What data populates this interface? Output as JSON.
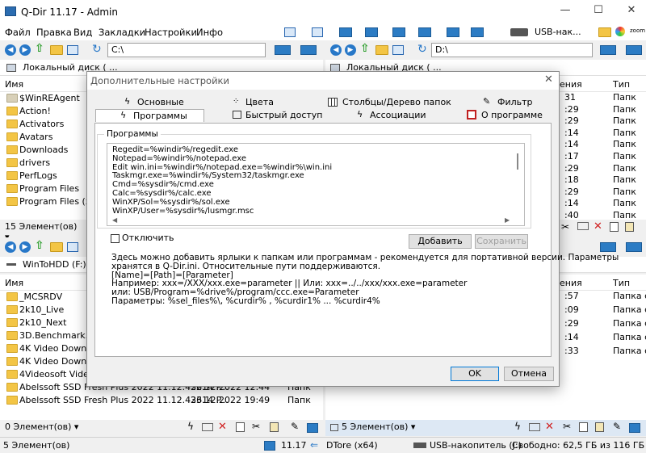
{
  "window": {
    "title": "Q-Dir 11.17 - Admin"
  },
  "menu": [
    "Файл",
    "Правка",
    "Вид",
    "Закладки",
    "Настройки",
    "Инфо"
  ],
  "menu_right": {
    "usb_label": "USB-нак...",
    "zoom_label": "zoom"
  },
  "top_left": {
    "path": "C:\\",
    "addr": "Локальный диск ( ...",
    "col_name": "Имя",
    "rows": [
      "$WinREAgent",
      "Action!",
      "Activators",
      "Avatars",
      "Downloads",
      "drivers",
      "PerfLogs",
      "Program Files",
      "Program Files (x86)"
    ],
    "status": "15 Элемент(ов)"
  },
  "top_right": {
    "path": "D:\\",
    "addr": "Локальный диск ( ...",
    "col_date": "ения",
    "col_type": "Тип",
    "dates": [
      "31",
      ":29",
      ":29",
      ":14",
      ":14",
      ":17",
      ":29",
      ":18",
      ":29",
      ":14",
      ":40"
    ],
    "types": [
      "Папк",
      "Папк",
      "Папк",
      "Папк",
      "Папк",
      "Папк",
      "Папк",
      "Папк",
      "Папк",
      "Папк",
      "Папк"
    ]
  },
  "bottom_left": {
    "addr": "WinToHDD (F:)",
    "col_name": "Имя",
    "rows": [
      {
        "name": "_MCSRDV",
        "date": "",
        "type": ""
      },
      {
        "name": "2k10_Live",
        "date": "",
        "type": ""
      },
      {
        "name": "2k10_Next",
        "date": "",
        "type": ""
      },
      {
        "name": "3D.Benchmark.OK",
        "date": "",
        "type": ""
      },
      {
        "name": "4K Video Downloa",
        "date": "",
        "type": ""
      },
      {
        "name": "4K Video Downloa",
        "date": "",
        "type": ""
      },
      {
        "name": "4Videosoft Video C",
        "date": "",
        "type": ""
      },
      {
        "name": "Abelssoft SSD Fresh Plus 2022 11.12.43614 P...",
        "date": "22.12.2022 12:44",
        "type": "Папк"
      },
      {
        "name": "Abelssoft SSD Fresh Plus 2022 11.12.43614 P...",
        "date": "23.12.2022 19:49",
        "type": "Папк"
      }
    ],
    "status": "0 Элемент(ов)"
  },
  "bottom_right": {
    "col_date": "ения",
    "col_type": "Тип",
    "dates": [
      ":57",
      ":09",
      ":29",
      ":14",
      ":33"
    ],
    "types": [
      "Папка с",
      "Папка с",
      "Папка с",
      "Папка с",
      "Папка с"
    ],
    "status": "5 Элемент(ов)"
  },
  "bottom_bar": {
    "count": "5 Элемент(ов)",
    "version": "11.17",
    "drive": "DTore (x64)",
    "usb": "USB-накопитель (J:)",
    "free": "Свободно: 62,5 ГБ из 116 ГБ"
  },
  "dialog": {
    "title": "Дополнительные настройки",
    "tabs_row1": [
      "Основные",
      "Цвета",
      "Столбцы/Дерево папок",
      "Фильтр"
    ],
    "tabs_row2": [
      "Программы",
      "Быстрый доступ",
      "Ассоциации",
      "О программе"
    ],
    "group_label": "Программы",
    "lines": [
      "Regedit=%windir%/regedit.exe",
      "Notepad=%windir%/notepad.exe",
      "Edit win.ini=%windir%/notepad.exe=%windir%\\win.ini",
      "Taskmgr.exe=%windir%/System32/taskmgr.exe",
      "Cmd=%sysdir%/cmd.exe",
      "Calc=%sysdir%/calc.exe",
      "WinXP/Sol=%sysdir%/sol.exe",
      "WinXP/User=%sysdir%/lusmgr.msc"
    ],
    "disable_label": "Отключить",
    "add_button": "Добавить",
    "save_button": "Сохранить",
    "info_lines": [
      "Здесь можно добавить ярлыки к папкам или программам - рекомендуется для портативной версии. Параметры",
      "хранятся в Q-Dir.ini. Относительные пути поддерживаются.",
      "[Name]=[Path]=[Parameter]",
      "Например: xxx=/XXX/xxx.exe=parameter || Или: xxx=../../xxx/xxx.exe=parameter",
      " или: USB/Program=%drive%/program/ccc.exe=Parameter",
      " Параметры: %sel_files%\\, %curdir% , %curdir1% ... %curdir4%"
    ],
    "ok": "OK",
    "cancel": "Отмена"
  }
}
